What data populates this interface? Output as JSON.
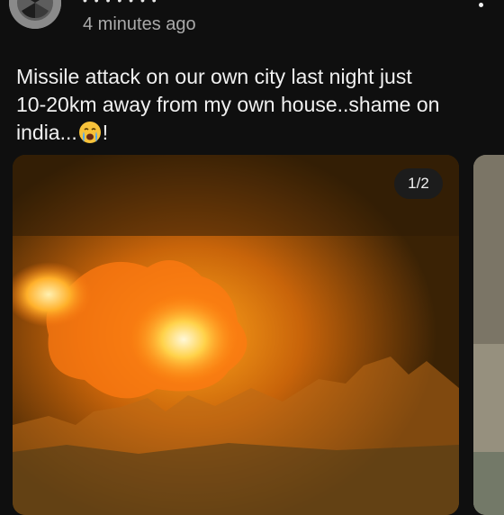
{
  "post": {
    "username": "• • • • • • •",
    "timestamp": "4 minutes ago",
    "text_line1": "Missile attack on our own city last night just",
    "text_line2": "10-20km away from my own house..shame on",
    "text_line3_before_emoji": "india...",
    "text_line3_after_emoji": "!",
    "emoji": "crying-face-emoji"
  },
  "media": {
    "counter": "1/2",
    "current_index": 1,
    "total": 2
  },
  "icons": {
    "avatar": "avatar-icon",
    "menu": "more-vertical-icon"
  },
  "colors": {
    "background": "#0f0f0f",
    "text_primary": "#f1f1f1",
    "text_secondary": "#aaaaaa",
    "counter_bg": "#1c1c1c"
  }
}
